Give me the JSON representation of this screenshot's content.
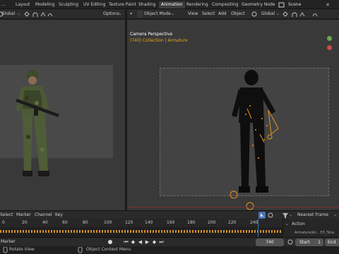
{
  "workspace_tabs": [
    "Layout",
    "Modeling",
    "Sculpting",
    "UV Editing",
    "Texture Paint",
    "Shading",
    "Animation",
    "Rendering",
    "Compositing",
    "Geometry Node"
  ],
  "active_tab": "Animation",
  "scene": {
    "label": "Scene"
  },
  "left_viewport": {
    "orientation": "Global",
    "options_label": "Options"
  },
  "right_viewport": {
    "mode": "Object Mode",
    "menu": [
      "View",
      "Select",
      "Add",
      "Object"
    ],
    "orientation": "Global",
    "camera_label": "Camera Perspective",
    "collection_label": "(740) Collection | Armature"
  },
  "timeline": {
    "menu": [
      "Select",
      "Marker",
      "Channel",
      "Key"
    ],
    "snap": "Nearest Frame",
    "ticks": [
      "0",
      "20",
      "40",
      "60",
      "80",
      "100",
      "120",
      "140",
      "160",
      "180",
      "200",
      "220",
      "240"
    ],
    "current_frame": "740",
    "side_panel_title": "Action",
    "side_panel_row": "Armature|Ar... E3_Tera"
  },
  "playback": {
    "marker_label": "Marker",
    "frame_field": "740",
    "start_label": "Start",
    "start_value": "1",
    "end_label": "End"
  },
  "status_bar": {
    "rotate": "Rotate View",
    "context": "Object Context Menu"
  },
  "colors": {
    "accent": "#4772b3",
    "bone_orange": "#e8951f",
    "selected_text": "#e6a519"
  }
}
